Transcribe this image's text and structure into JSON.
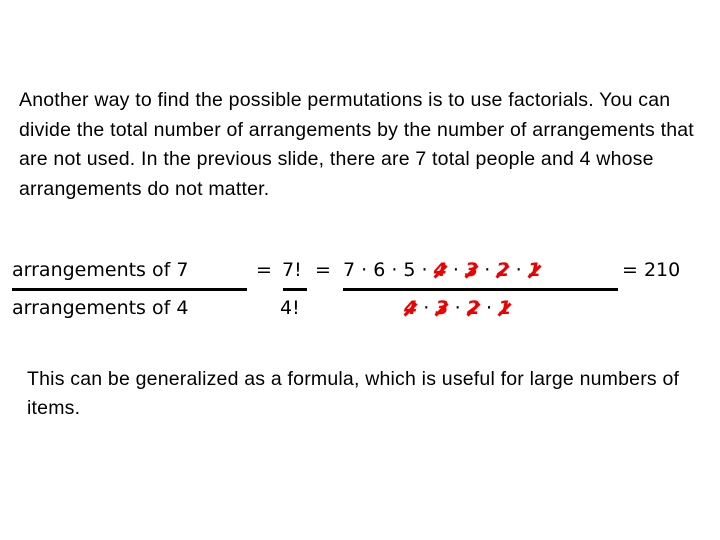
{
  "intro_text": "Another way to find the possible permutations is to use factorials. You can divide the total number of arrangements by the number of arrangements that are not used. In the previous slide, there are 7 total people and 4 whose arrangements do not matter.",
  "formula": {
    "left_numerator": "arrangements of 7",
    "left_denominator": "arrangements of 4",
    "eq1": "=",
    "fact_numerator": "7!",
    "fact_denominator": "4!",
    "eq2": "=",
    "product_kept": "7 · 6 · 5 ·",
    "cancelled_numerator": [
      "4",
      "3",
      "2",
      "1"
    ],
    "cancelled_denominator": [
      "4",
      "3",
      "2",
      "1"
    ],
    "dot": "·",
    "result": "= 210"
  },
  "conclusion_text": "This can be generalized as a formula, which is useful for large numbers of items.",
  "colors": {
    "cancel": "#ee0000",
    "text": "#000000"
  }
}
